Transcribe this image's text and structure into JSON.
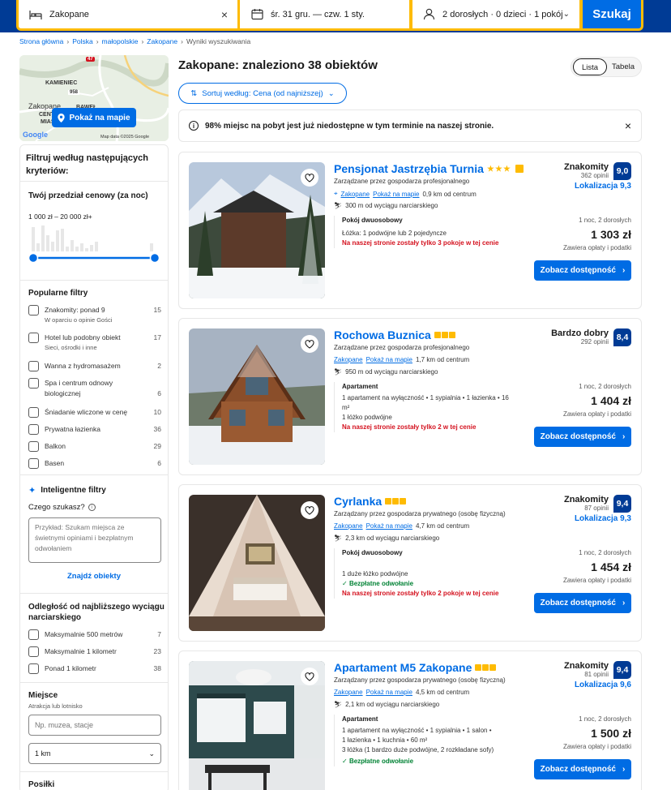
{
  "search": {
    "destination": "Zakopane",
    "dates": "śr. 31 gru.  —  czw. 1 sty.",
    "guests": "2 dorosłych · 0 dzieci · 1 pokój",
    "button": "Szukaj"
  },
  "breadcrumb": [
    "Strona główna",
    "Polska",
    "małopolskie",
    "Zakopane",
    "Wyniki wyszukiwania"
  ],
  "map": {
    "button": "Pokaż na mapie",
    "labels": [
      "KAMIENIEC",
      "Zakopane",
      "CENTRUM",
      "MIASTA",
      "BAWEŁ"
    ],
    "road": "47",
    "road2": "958",
    "attribution": "Map data ©2025 Google",
    "brand": "Google"
  },
  "filters": {
    "heading": "Filtruj według następujących kryteriów:",
    "price": {
      "title": "Twój przedział cenowy (za noc)",
      "range": "1 000 zł – 20 000 zł+",
      "min_fraction": 0.0,
      "max_fraction": 1.0
    },
    "popular": {
      "title": "Popularne filtry",
      "items": [
        {
          "label": "Znakomity: ponad 9",
          "sub": "W oparciu o opinie Gości",
          "count": "15"
        },
        {
          "label": "Hotel lub podobny obiekt",
          "sub": "Sieci, ośrodki i inne",
          "count": "17"
        },
        {
          "label": "Wanna z hydromasażem",
          "sub": "",
          "count": "2"
        },
        {
          "label": "Spa i centrum odnowy biologicznej",
          "sub": "",
          "count": "6"
        },
        {
          "label": "Śniadanie wliczone w cenę",
          "sub": "",
          "count": "10"
        },
        {
          "label": "Prywatna łazienka",
          "sub": "",
          "count": "36"
        },
        {
          "label": "Balkon",
          "sub": "",
          "count": "29"
        },
        {
          "label": "Basen",
          "sub": "",
          "count": "6"
        }
      ]
    },
    "smart": {
      "title": "Inteligentne filtry",
      "question": "Czego szukasz?",
      "placeholder": "Przykład: Szukam miejsca ze świetnymi opiniami i bezpłatnym odwołaniem",
      "button": "Znajdź obiekty"
    },
    "ski": {
      "title": "Odległość od najbliższego wyciągu narciarskiego",
      "items": [
        {
          "label": "Maksymalnie 500 metrów",
          "count": "7"
        },
        {
          "label": "Maksymalnie 1 kilometr",
          "count": "23"
        },
        {
          "label": "Ponad 1 kilometr",
          "count": "38"
        }
      ]
    },
    "place": {
      "title": "Miejsce",
      "sub": "Atrakcja lub lotnisko",
      "placeholder": "Np. muzea, stacje",
      "radius": "1 km"
    },
    "next_title": "Posiłki"
  },
  "results": {
    "title": "Zakopane: znaleziono 38 obiektów",
    "view_list": "Lista",
    "view_table": "Tabela",
    "sort": "Sortuj według: Cena (od najniższej)",
    "notice": "98% miejsc na pobyt jest już niedostępne w tym terminie na naszej stronie.",
    "cards": [
      {
        "name": "Pensjonat Jastrzębia Turnia",
        "stars": 3,
        "star_type": "star",
        "thumb": true,
        "managed": "Zarządzane przez gospodarza profesjonalnego",
        "city": "Zakopane",
        "map_link": "Pokaż na mapie",
        "distance": "0,9 km od centrum",
        "ski": "300 m od wyciągu narciarskiego",
        "room_type": "Pokój dwuosobowy",
        "room_desc": [
          "Łóżka: 1 podwójne lub 2 pojedyncze"
        ],
        "free_cancel": "",
        "warning": "Na naszej stronie zostały tylko 3 pokoje w tej cenie",
        "rating_word": "Znakomity",
        "reviews": "362 opinii",
        "score": "9,0",
        "location_score": "Lokalizacja 9,3",
        "nights": "1 noc, 2 dorosłych",
        "price": "1 303 zł",
        "fees": "Zawiera opłaty i podatki",
        "cta": "Zobacz dostępność"
      },
      {
        "name": "Rochowa Buznica",
        "stars": 3,
        "star_type": "sq",
        "thumb": false,
        "managed": "Zarządzane przez gospodarza profesjonalnego",
        "city": "Zakopane",
        "map_link": "Pokaż na mapie",
        "distance": "1,7 km od centrum",
        "ski": "950 m od wyciągu narciarskiego",
        "room_type": "Apartament",
        "room_desc": [
          "1 apartament na wyłączność • 1 sypialnia • 1 łazienka • 16 m²",
          "1 łóżko podwójne"
        ],
        "free_cancel": "",
        "warning": "Na naszej stronie zostały tylko 2 w tej cenie",
        "rating_word": "Bardzo dobry",
        "reviews": "292 opinii",
        "score": "8,4",
        "location_score": "",
        "nights": "1 noc, 2 dorosłych",
        "price": "1 404 zł",
        "fees": "Zawiera opłaty i podatki",
        "cta": "Zobacz dostępność"
      },
      {
        "name": "Cyrlanka",
        "stars": 3,
        "star_type": "sq",
        "thumb": false,
        "managed": "Zarządzany przez gospodarza prywatnego (osobę fizyczną)",
        "city": "Zakopane",
        "map_link": "Pokaż na mapie",
        "distance": "4,7 km od centrum",
        "ski": "2,3 km od wyciągu narciarskiego",
        "room_type": "Pokój dwuosobowy",
        "room_desc": [
          "",
          "1 duże łóżko podwójne"
        ],
        "free_cancel": "Bezpłatne odwołanie",
        "warning": "Na naszej stronie zostały tylko 2 pokoje w tej cenie",
        "rating_word": "Znakomity",
        "reviews": "87 opinii",
        "score": "9,4",
        "location_score": "Lokalizacja 9,3",
        "nights": "1 noc, 2 dorosłych",
        "price": "1 454 zł",
        "fees": "Zawiera opłaty i podatki",
        "cta": "Zobacz dostępność"
      },
      {
        "name": "Apartament M5 Zakopane",
        "stars": 3,
        "star_type": "sq",
        "thumb": false,
        "managed": "Zarządzany przez gospodarza prywatnego (osobę fizyczną)",
        "city": "Zakopane",
        "map_link": "Pokaż na mapie",
        "distance": "4,5 km od centrum",
        "ski": "2,1 km od wyciągu narciarskiego",
        "room_type": "Apartament",
        "room_desc": [
          "1 apartament na wyłączność • 1 sypialnia • 1 salon •",
          "1 łazienka • 1 kuchnia • 60 m²",
          "3 łóżka (1 bardzo duże podwójne, 2 rozkładane sofy)"
        ],
        "free_cancel": "Bezpłatne odwołanie",
        "warning": "",
        "rating_word": "Znakomity",
        "reviews": "81 opinii",
        "score": "9,4",
        "location_score": "Lokalizacja 9,6",
        "nights": "1 noc, 2 dorosłych",
        "price": "1 500 zł",
        "fees": "Zawiera opłaty i podatki",
        "cta": "Zobacz dostępność"
      }
    ]
  },
  "colors": {
    "brand": "#003b95",
    "accent": "#006ce4",
    "highlight": "#febb02",
    "warning": "#d4111e",
    "success": "#008234"
  }
}
